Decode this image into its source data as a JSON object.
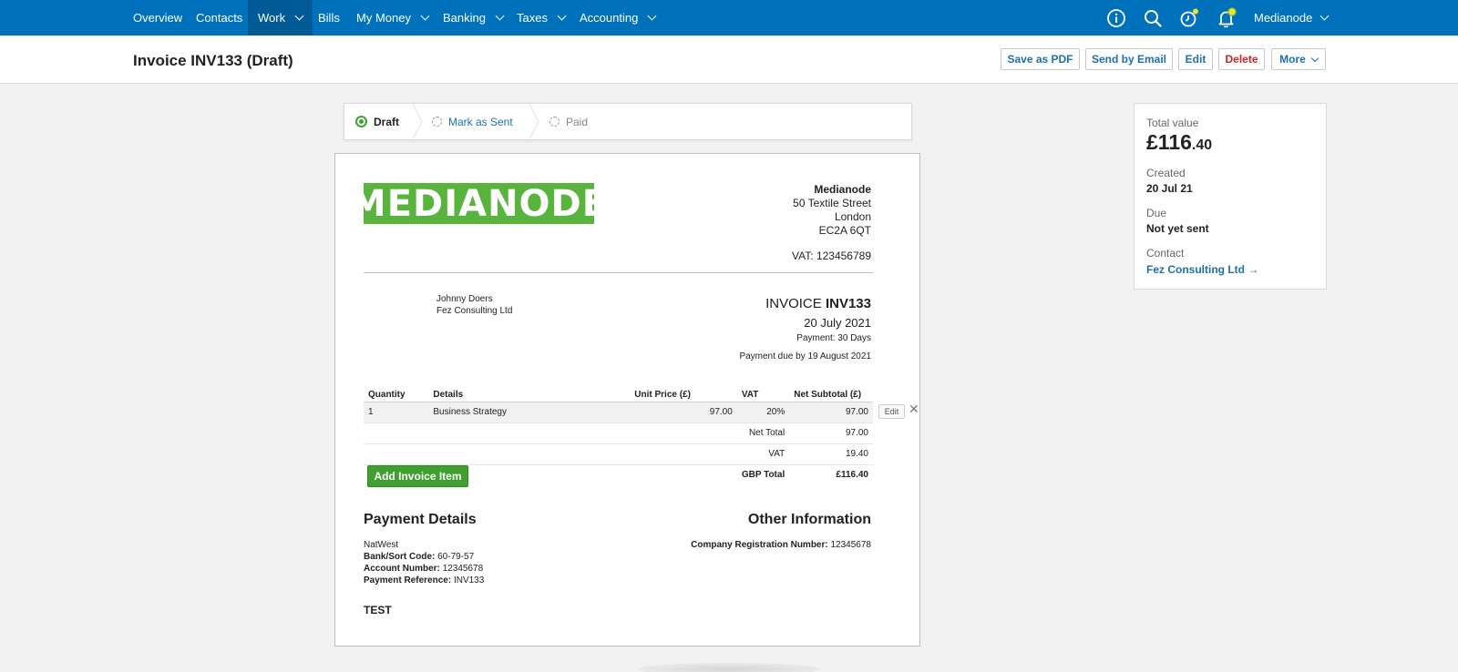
{
  "nav": {
    "items": [
      {
        "label": "Overview",
        "dropdown": false,
        "active": false
      },
      {
        "label": "Contacts",
        "dropdown": false,
        "active": false
      },
      {
        "label": "Work",
        "dropdown": true,
        "active": true
      },
      {
        "label": "Bills",
        "dropdown": false,
        "active": false
      },
      {
        "label": "My Money",
        "dropdown": true,
        "active": false
      },
      {
        "label": "Banking",
        "dropdown": true,
        "active": false
      },
      {
        "label": "Taxes",
        "dropdown": true,
        "active": false
      },
      {
        "label": "Accounting",
        "dropdown": true,
        "active": false
      }
    ],
    "icons": [
      "info-icon",
      "search-icon",
      "timer-icon",
      "notifications-bell-icon"
    ],
    "account_label": "Medianode"
  },
  "header": {
    "title": "Invoice INV133 (Draft)",
    "buttons": {
      "save_pdf": "Save as PDF",
      "send_email": "Send by Email",
      "edit": "Edit",
      "delete": "Delete",
      "more": "More"
    }
  },
  "status": {
    "steps": [
      {
        "label": "Draft",
        "state": "current"
      },
      {
        "label": "Mark as Sent",
        "state": "link"
      },
      {
        "label": "Paid",
        "state": "disabled"
      }
    ]
  },
  "invoice": {
    "logo_text": "MEDIANODE",
    "company": {
      "name": "Medianode",
      "address1": "50 Textile Street",
      "city": "London",
      "postcode": "EC2A 6QT",
      "vat": "VAT: 123456789"
    },
    "recipient": {
      "person": "Johnny Doers",
      "company": "Fez Consulting Ltd"
    },
    "meta": {
      "invoice_word": "INVOICE",
      "invoice_number": "INV133",
      "date": "20 July 2021",
      "payment_terms": "Payment: 30 Days",
      "payment_due": "Payment due by 19 August 2021"
    },
    "columns": {
      "quantity": "Quantity",
      "details": "Details",
      "unit_price": "Unit Price (£)",
      "vat": "VAT",
      "net_subtotal": "Net Subtotal (£)"
    },
    "line_items": [
      {
        "quantity": "1",
        "details": "Business Strategy",
        "unit_price": "97.00",
        "vat": "20%",
        "net_subtotal": "97.00"
      }
    ],
    "line_edit_label": "Edit",
    "line_remove_glyph": "✕",
    "totals": {
      "net_total_label": "Net Total",
      "net_total": "97.00",
      "vat_label": "VAT",
      "vat": "19.40",
      "gbp_total_label": "GBP Total",
      "gbp_total": "£116.40"
    },
    "add_item_label": "Add Invoice Item",
    "payment_details": {
      "heading": "Payment Details",
      "bank_name": "NatWest",
      "sort_code_label": "Bank/Sort Code:",
      "sort_code": "60-79-57",
      "account_label": "Account Number:",
      "account": "12345678",
      "reference_label": "Payment Reference:",
      "reference": "INV133"
    },
    "other_info": {
      "heading": "Other Information",
      "reg_label": "Company Registration Number:",
      "reg_number": "12345678"
    },
    "notes": "TEST"
  },
  "summary": {
    "total_label": "Total value",
    "total_major": "£116",
    "total_minor": ".40",
    "created_label": "Created",
    "created": "20 Jul 21",
    "due_label": "Due",
    "due": "Not yet sent",
    "contact_label": "Contact",
    "contact": "Fez Consulting Ltd →"
  },
  "colors": {
    "nav_bg": "#0072bb",
    "nav_active": "#005a96",
    "link": "#1d6fb0",
    "danger": "#d0221f",
    "success": "#3f9f2f",
    "logo_green": "#59b43d"
  }
}
